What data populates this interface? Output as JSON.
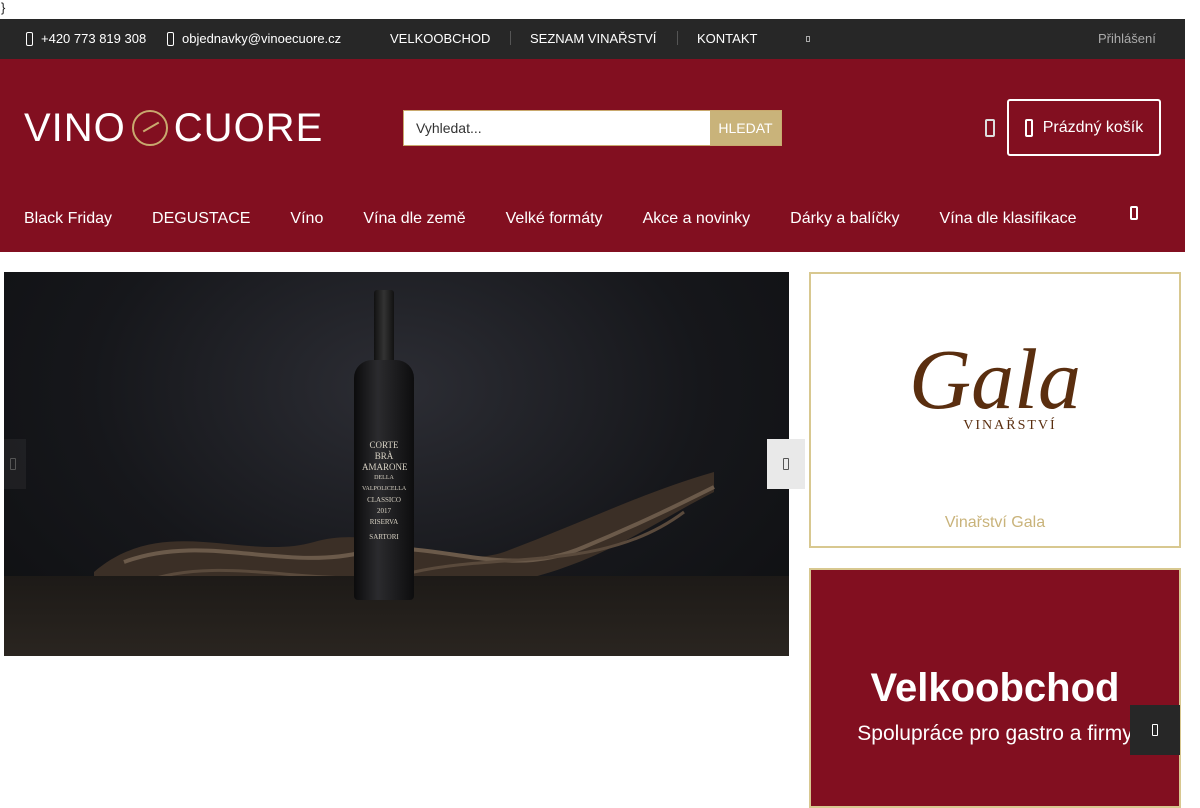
{
  "stray_char": "}",
  "topbar": {
    "phone": "+420 773 819 308",
    "email": "objednavky@vinoecuore.cz",
    "links": [
      "VELKOOBCHOD",
      "SEZNAM VINAŘSTVÍ",
      "KONTAKT"
    ],
    "login": "Přihlášení"
  },
  "header": {
    "logo_left": "VINO",
    "logo_right": "CUORE",
    "search_placeholder": "Vyhledat...",
    "search_button": "HLEDAT",
    "cart_label": "Prázdný košík"
  },
  "menu": [
    "Black Friday",
    "DEGUSTACE",
    "Víno",
    "Vína dle země",
    "Velké formáty",
    "Akce a novinky",
    "Dárky a balíčky",
    "Vína dle klasifikace"
  ],
  "slider": {
    "bottle_label": [
      "CORTE BRÀ",
      "AMARONE",
      "DELLA VALPOLICELLA",
      "CLASSICO 2017",
      "RISERVA",
      "SARTORI"
    ]
  },
  "gala": {
    "logo_script": "Gala",
    "logo_sub": "VINAŘSTVÍ",
    "name": "Vinařství Gala"
  },
  "velko": {
    "title": "Velkoobchod",
    "subtitle": "Spolupráce pro gastro a firmy"
  },
  "colors": {
    "brand": "#820f20",
    "gold": "#c9b37a",
    "topbar": "#272727"
  }
}
